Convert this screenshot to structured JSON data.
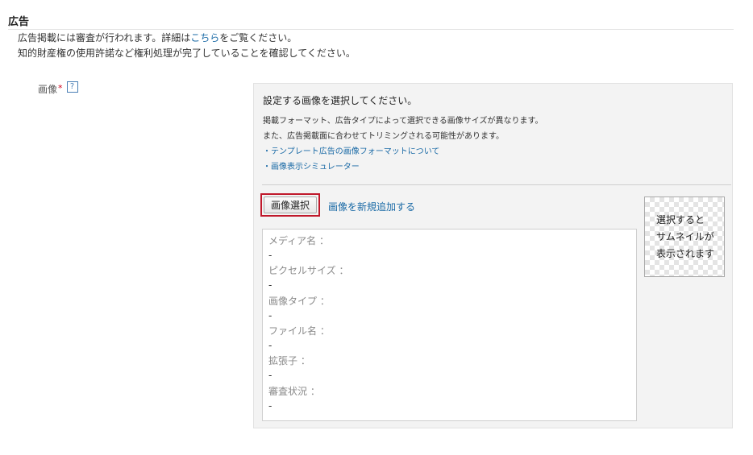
{
  "section": {
    "title": "広告"
  },
  "notice": {
    "line1_before": "広告掲載には審査が行われます。詳細は",
    "line1_link": "こちら",
    "line1_after": "をご覧ください。",
    "line2": "知的財産権の使用許諾など権利処理が完了していることを確認してください。"
  },
  "field": {
    "label": "画像",
    "required_mark": "*",
    "help": "?"
  },
  "panel": {
    "heading": "設定する画像を選択してください。",
    "desc_line1": "掲載フォーマット、広告タイプによって選択できる画像サイズが異なります。",
    "desc_line2": "また、広告掲載面に合わせてトリミングされる可能性があります。",
    "link1": "・テンプレート広告の画像フォーマットについて",
    "link2": "・画像表示シミュレーター"
  },
  "actions": {
    "select_button": "画像選択",
    "add_new_link": "画像を新規追加する"
  },
  "info": [
    {
      "key": "メディア名 ：",
      "value": "-"
    },
    {
      "key": "ピクセルサイズ ：",
      "value": "-"
    },
    {
      "key": "画像タイプ ：",
      "value": "-"
    },
    {
      "key": "ファイル名 ：",
      "value": "-"
    },
    {
      "key": "拡張子 ：",
      "value": "-"
    },
    {
      "key": "審査状況 ：",
      "value": "-"
    }
  ],
  "thumbnail": {
    "line1": "選択すると",
    "line2": "サムネイルが",
    "line3": "表示されます"
  },
  "colors": {
    "link": "#1a6aa6",
    "highlight_border": "#c0182b",
    "required": "#d0021b"
  }
}
